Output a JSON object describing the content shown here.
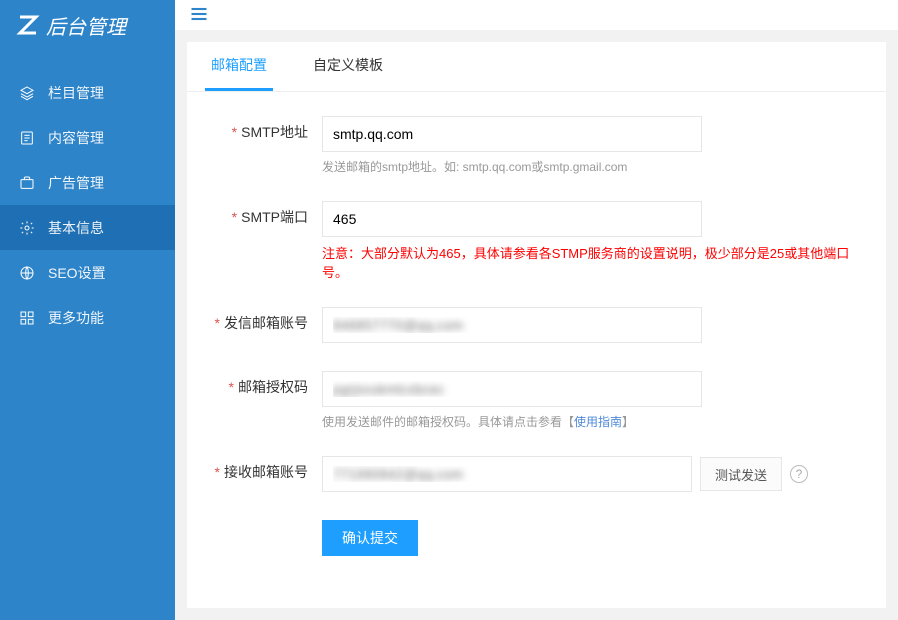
{
  "logo": {
    "text": "后台管理"
  },
  "sidebar": {
    "items": [
      {
        "label": "栏目管理"
      },
      {
        "label": "内容管理"
      },
      {
        "label": "广告管理"
      },
      {
        "label": "基本信息"
      },
      {
        "label": "SEO设置"
      },
      {
        "label": "更多功能"
      }
    ]
  },
  "tabs": {
    "items": [
      {
        "label": "邮箱配置"
      },
      {
        "label": "自定义模板"
      }
    ]
  },
  "form": {
    "smtp_addr": {
      "label": "SMTP地址",
      "value": "smtp.qq.com",
      "help": "发送邮箱的smtp地址。如: smtp.qq.com或smtp.gmail.com"
    },
    "smtp_port": {
      "label": "SMTP端口",
      "value": "465",
      "help": "注意：大部分默认为465，具体请参看各STMP服务商的设置说明，极少部分是25或其他端口号。"
    },
    "sender": {
      "label": "发信邮箱账号",
      "value": "846857770@qq.com"
    },
    "auth_code": {
      "label": "邮箱授权码",
      "value": "pgrjsvukmtcxbcec",
      "help_before": "使用发送邮件的邮箱授权码。具体请点击参看【",
      "help_link": "使用指南",
      "help_after": "】"
    },
    "receiver": {
      "label": "接收邮箱账号",
      "value": "771990842@qq.com",
      "test_btn": "测试发送"
    },
    "submit": "确认提交"
  }
}
